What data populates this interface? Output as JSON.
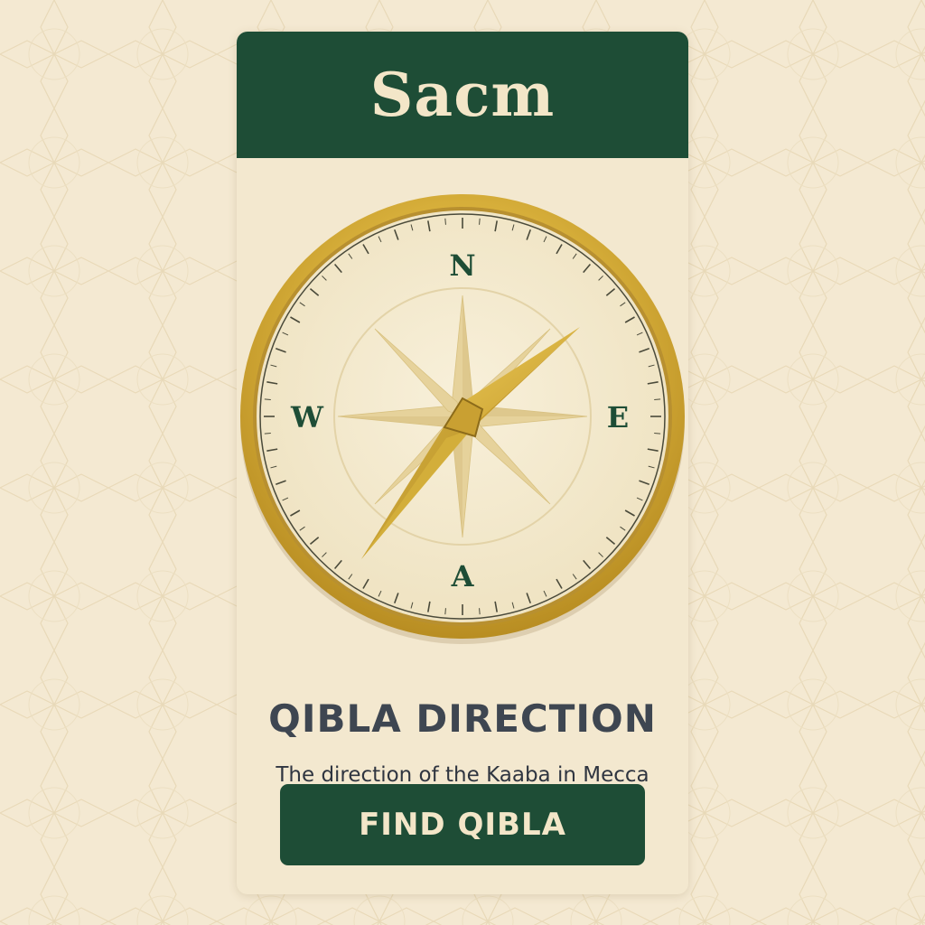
{
  "header": {
    "title": "Sacm"
  },
  "compass": {
    "north_label": "N",
    "east_label": "E",
    "west_label": "W",
    "south_label": "A",
    "needle_icon": "compass-needle-icon",
    "rose_icon": "compass-rose-icon"
  },
  "main": {
    "title": "QIBLA DIRECTION",
    "subtitle": "The direction of the Kaaba in Mecca",
    "button_label": "FIND QIBLA"
  },
  "colors": {
    "background": "#f4e9d2",
    "card": "#f3e8cf",
    "brand_green": "#1e4d36",
    "gold": "#d9b444",
    "text_dark": "#3e4651",
    "header_text": "#f3e6c8"
  }
}
